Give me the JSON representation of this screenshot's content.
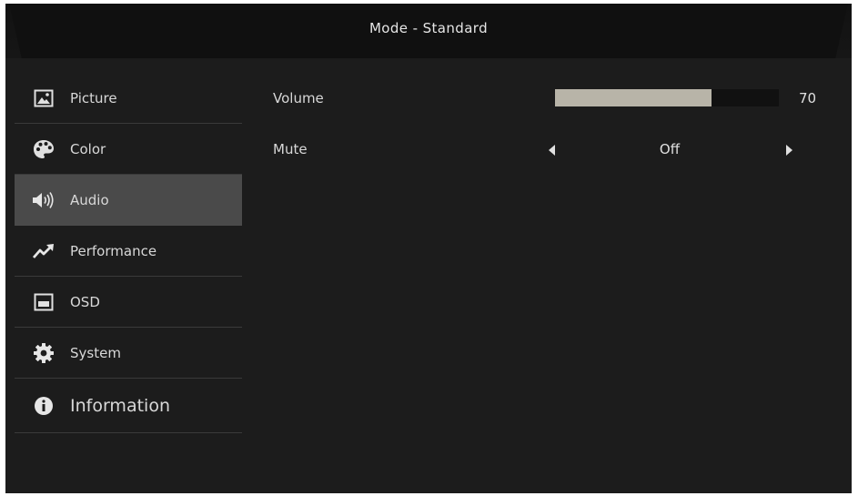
{
  "header": {
    "title": "Mode - Standard"
  },
  "sidebar": {
    "items": [
      {
        "label": "Picture",
        "icon": "picture-icon"
      },
      {
        "label": "Color",
        "icon": "palette-icon"
      },
      {
        "label": "Audio",
        "icon": "speaker-icon",
        "selected": true
      },
      {
        "label": "Performance",
        "icon": "trend-up-icon"
      },
      {
        "label": "OSD",
        "icon": "osd-window-icon"
      },
      {
        "label": "System",
        "icon": "gear-icon"
      },
      {
        "label": "Information",
        "icon": "info-icon"
      }
    ]
  },
  "audio": {
    "volume": {
      "label": "Volume",
      "value": "70",
      "percent": 70
    },
    "mute": {
      "label": "Mute",
      "value": "Off"
    }
  },
  "colors": {
    "background": "#1c1c1c",
    "selected_item": "#4a4a4a",
    "slider_fill": "#b8b4a8",
    "slider_track": "#111111",
    "text": "#d8d8d8"
  }
}
